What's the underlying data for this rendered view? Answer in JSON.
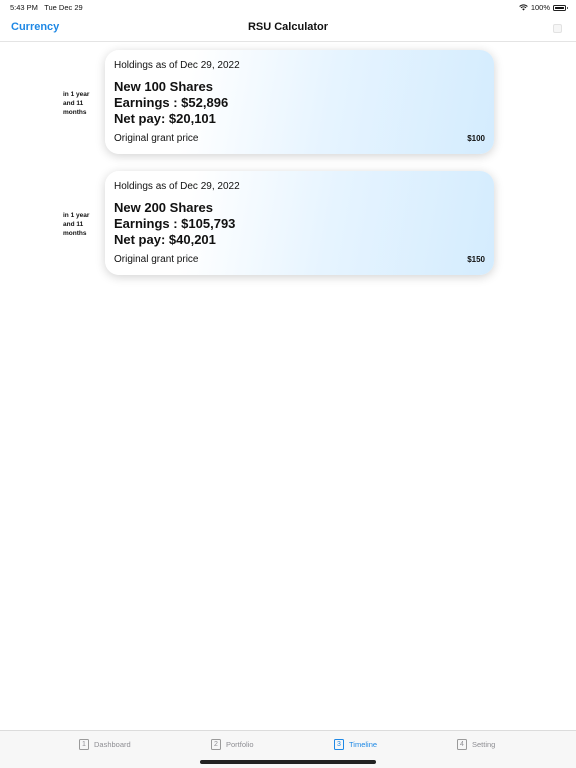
{
  "status_bar": {
    "time": "5:43 PM",
    "date": "Tue Dec 29",
    "battery": "100%"
  },
  "nav": {
    "left_button": "Currency",
    "title": "RSU Calculator"
  },
  "timeline": [
    {
      "time_label": "in 1 year and 11 months",
      "holdings": "Holdings as of Dec 29, 2022",
      "shares": "New 100 Shares",
      "earnings": "Earnings : $52,896",
      "net_pay": "Net pay: $20,101",
      "grant_label": "Original grant price",
      "grant_price": "$100"
    },
    {
      "time_label": "in 1 year and 11 months",
      "holdings": "Holdings as of Dec 29, 2022",
      "shares": "New 200 Shares",
      "earnings": "Earnings : $105,793",
      "net_pay": "Net pay: $40,201",
      "grant_label": "Original grant price",
      "grant_price": "$150"
    }
  ],
  "tabs": [
    {
      "number": "1",
      "label": "Dashboard",
      "active": false
    },
    {
      "number": "2",
      "label": "Portfolio",
      "active": false
    },
    {
      "number": "3",
      "label": "Timeline",
      "active": true
    },
    {
      "number": "4",
      "label": "Setting",
      "active": false
    }
  ],
  "colors": {
    "accent": "#1e88e5",
    "inactive_tab": "#8e8e93",
    "card_gradient_end": "#d4ecfe"
  }
}
